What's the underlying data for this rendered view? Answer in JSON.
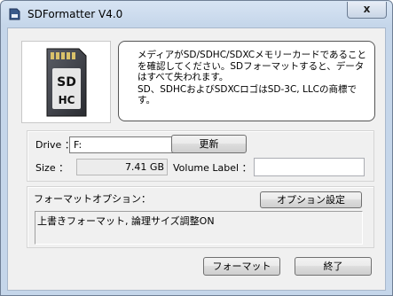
{
  "window": {
    "title": "SDFormatter V4.0",
    "close_glyph": "x",
    "icon": "sd-card-icon"
  },
  "message": {
    "line1": "メディアがSD/SDHC/SDXCメモリーカードであることを確認してください。SDフォーマットすると、データはすべて失われます。",
    "line2": "SD、SDHCおよびSDXCロゴはSD-3C, LLCの商標です。"
  },
  "drive": {
    "label": "Drive ：",
    "selected": "F:",
    "refresh_button": "更新"
  },
  "size": {
    "label": "Size  ：",
    "value": "7.41 GB"
  },
  "volume": {
    "label": "Volume Label ：",
    "value": ""
  },
  "options": {
    "label": "フォーマットオプション：",
    "settings_button": "オプション設定",
    "summary": "上書きフォーマット, 論理サイズ調整ON"
  },
  "footer": {
    "format_button": "フォーマット",
    "exit_button": "終了"
  },
  "sd_logo": {
    "line1": "SD",
    "line2": "HC"
  }
}
